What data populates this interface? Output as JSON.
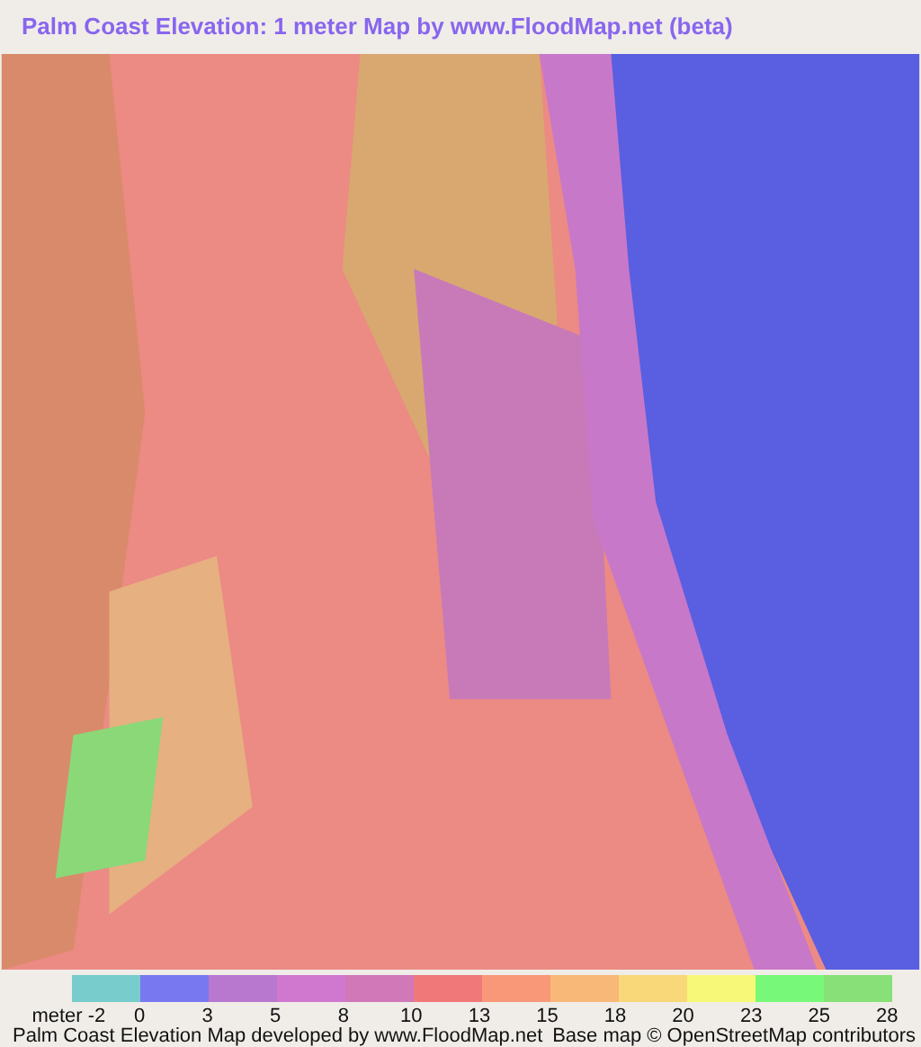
{
  "title": "Palm Coast Elevation: 1 meter Map by www.FloodMap.net (beta)",
  "legend": {
    "unit_label": "meter -2",
    "swatches": [
      {
        "color": "#78cccc",
        "label": "0"
      },
      {
        "color": "#7878f0",
        "label": "3"
      },
      {
        "color": "#b878d0",
        "label": "5"
      },
      {
        "color": "#d078d0",
        "label": "8"
      },
      {
        "color": "#d078b8",
        "label": "10"
      },
      {
        "color": "#f07878",
        "label": "13"
      },
      {
        "color": "#f89878",
        "label": "15"
      },
      {
        "color": "#f8b878",
        "label": "18"
      },
      {
        "color": "#f8d878",
        "label": "20"
      },
      {
        "color": "#f8f878",
        "label": "23"
      },
      {
        "color": "#78f878",
        "label": "25"
      },
      {
        "color": "#88e078",
        "label": "28"
      }
    ]
  },
  "footer": {
    "credit": "Palm Coast Elevation Map developed by www.FloodMap.net",
    "attribution": "Base map © OpenStreetMap contributors"
  }
}
